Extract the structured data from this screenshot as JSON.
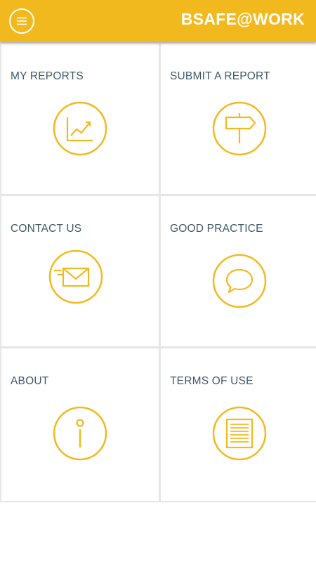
{
  "app": {
    "title": "BSAFE@WORK",
    "accent_color": "#f2b91f",
    "label_color": "#3e5a6b",
    "menu_icon": "hamburger-menu-icon"
  },
  "tiles": [
    {
      "label": "MY REPORTS",
      "icon": "chart-trend-icon"
    },
    {
      "label": "SUBMIT A REPORT",
      "icon": "signpost-icon"
    },
    {
      "label": "CONTACT US",
      "icon": "envelope-icon"
    },
    {
      "label": "GOOD PRACTICE",
      "icon": "speech-bubble-icon"
    },
    {
      "label": "ABOUT",
      "icon": "info-icon"
    },
    {
      "label": "TERMS OF USE",
      "icon": "document-icon"
    }
  ]
}
